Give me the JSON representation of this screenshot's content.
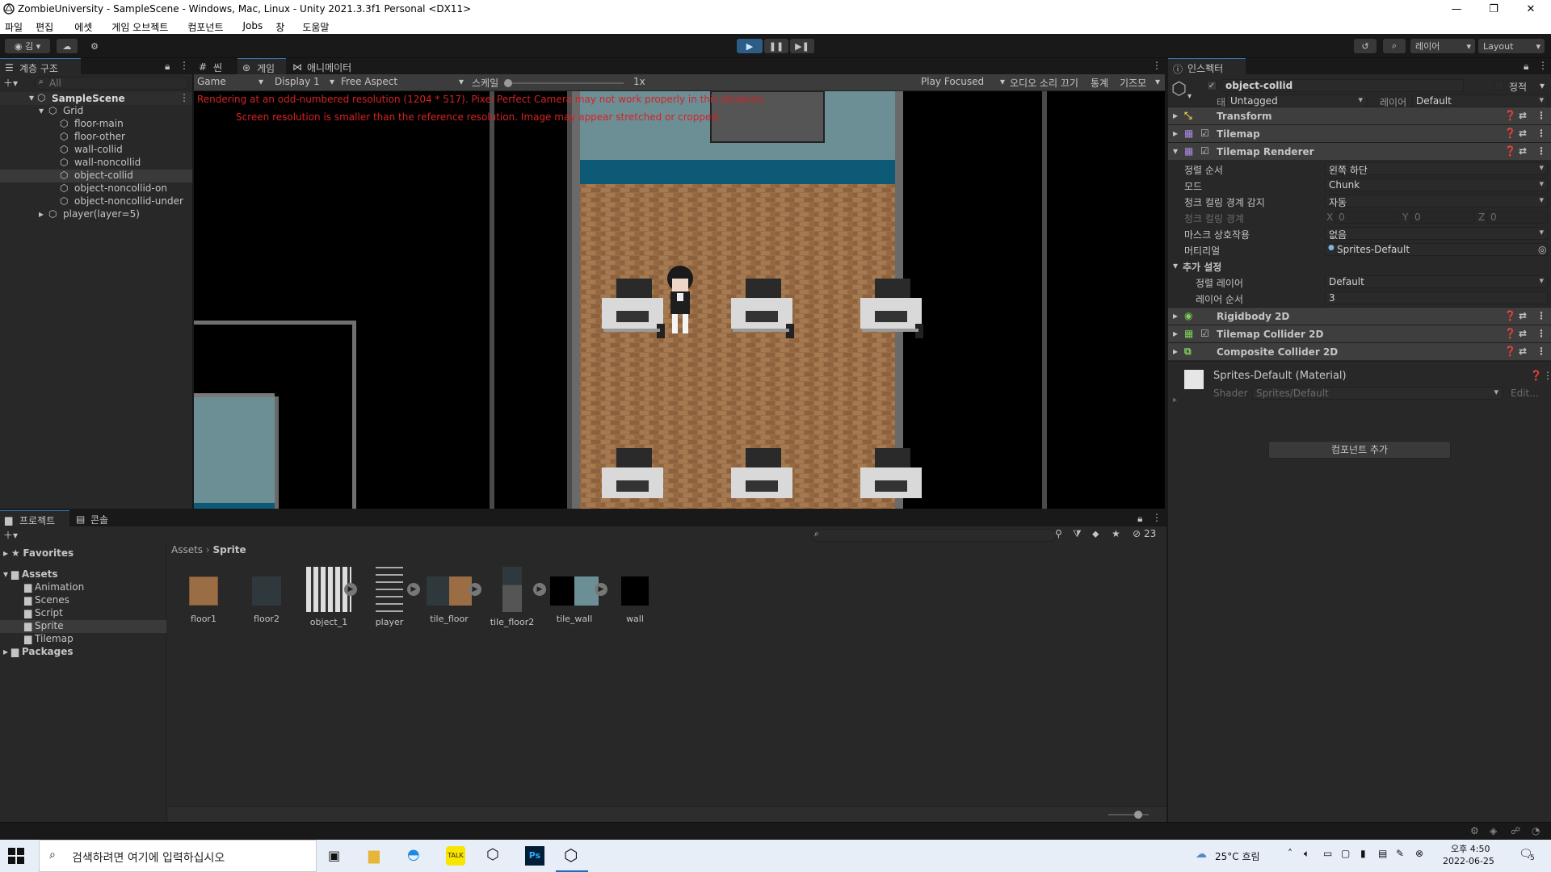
{
  "window": {
    "title": "ZombieUniversity - SampleScene - Windows, Mac, Linux - Unity 2021.3.3f1 Personal <DX11>",
    "min": "—",
    "max": "❐",
    "close": "✕"
  },
  "menu": [
    "파일",
    "편집",
    "에셋",
    "게임 오브젝트",
    "컴포넌트",
    "Jobs",
    "창",
    "도움말"
  ],
  "toolbar": {
    "account": "김",
    "layers": "레이어",
    "layout": "Layout"
  },
  "hierarchy": {
    "tab": "계층 구조",
    "search_placeholder": "All",
    "scene": "SampleScene",
    "items": [
      {
        "label": "Grid"
      },
      {
        "label": "floor-main"
      },
      {
        "label": "floor-other"
      },
      {
        "label": "wall-collid"
      },
      {
        "label": "wall-noncollid"
      },
      {
        "label": "object-collid"
      },
      {
        "label": "object-noncollid-on"
      },
      {
        "label": "object-noncollid-under"
      },
      {
        "label": "player(layer=5)"
      }
    ]
  },
  "game": {
    "tabs": [
      "씬",
      "게임",
      "애니메이터"
    ],
    "mode": "Game",
    "display": "Display 1",
    "aspect": "Free Aspect",
    "scale_label": "스케일",
    "scale_value": "1x",
    "play_focused": "Play Focused",
    "mute": "오디오 소리 끄기",
    "stats": "통계",
    "gizmos": "기즈모",
    "warning1": "Rendering at an odd-numbered resolution (1204 * 517). Pixel Perfect Camera may not work properly in this situation.",
    "warning2": "Screen resolution is smaller than the reference resolution. Image may appear stretched or cropped."
  },
  "inspector": {
    "tab": "인스펙터",
    "object_name": "object-collid",
    "static_label": "정적",
    "tag_label": "태그",
    "tag_value": "Untagged",
    "layer_label": "레이어",
    "layer_value": "Default",
    "components": {
      "transform": "Transform",
      "tilemap": "Tilemap",
      "renderer": "Tilemap Renderer",
      "rigidbody": "Rigidbody 2D",
      "collider": "Tilemap Collider 2D",
      "composite": "Composite Collider 2D"
    },
    "props": [
      {
        "label": "정렬 순서",
        "value": "왼쪽 하단"
      },
      {
        "label": "모드",
        "value": "Chunk"
      },
      {
        "label": "청크 컬링 경계 감지",
        "value": "자동"
      },
      {
        "label": "마스크 상호작용",
        "value": "없음"
      },
      {
        "label": "머티리얼",
        "value": "Sprites-Default"
      }
    ],
    "bounds_label": "청크 컬링 경계",
    "bounds": {
      "x": "0",
      "y": "0",
      "z": "0",
      "xl": "X",
      "yl": "Y",
      "zl": "Z"
    },
    "extra_label": "추가 설정",
    "sort_layer_label": "정렬 레이어",
    "sort_layer_value": "Default",
    "order_label": "레이어 순서",
    "order_value": "3",
    "material_title": "Sprites-Default (Material)",
    "shader_label": "Shader",
    "shader_value": "Sprites/Default",
    "edit": "Edit...",
    "add_component": "컴포넌트 추가"
  },
  "project": {
    "tabs": [
      "프로젝트",
      "콘솔"
    ],
    "favorites": "Favorites",
    "assets": "Assets",
    "folders": [
      "Animation",
      "Scenes",
      "Script",
      "Sprite",
      "Tilemap"
    ],
    "packages": "Packages",
    "breadcrumb": [
      "Assets",
      "Sprite"
    ],
    "hidden_count": "23",
    "files": [
      "floor1",
      "floor2",
      "object_1",
      "player",
      "tile_floor",
      "tile_floor2",
      "tile_wall",
      "wall"
    ]
  },
  "taskbar": {
    "search_placeholder": "검색하려면 여기에 입력하십시오",
    "weather": "25°C 흐림",
    "time": "오후 4:50",
    "date": "2022-06-25",
    "notif": "5"
  }
}
